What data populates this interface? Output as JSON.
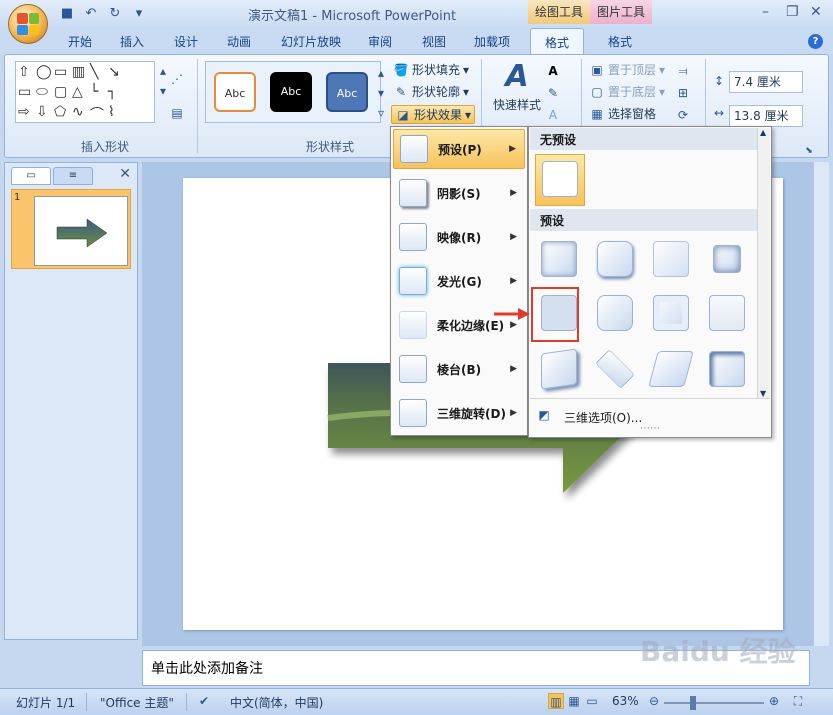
{
  "title_bar": {
    "title": "演示文稿1 - Microsoft PowerPoint",
    "context_drawing": "绘图工具",
    "context_picture": "图片工具"
  },
  "tabs": [
    "开始",
    "插入",
    "设计",
    "动画",
    "幻灯片放映",
    "审阅",
    "视图",
    "加载项",
    "格式",
    "格式"
  ],
  "ribbon": {
    "insert_shapes_label": "插入形状",
    "shape_styles_label": "形状样式",
    "style_samples": [
      "Abc",
      "Abc",
      "Abc"
    ],
    "shape_fill": "形状填充",
    "shape_outline": "形状轮廓",
    "shape_effects": "形状效果",
    "quick_styles": "快速样式",
    "bring_front": "置于顶层",
    "send_back": "置于底层",
    "selection_pane": "选择窗格",
    "height": "7.4 厘米",
    "width": "13.8 厘米"
  },
  "menu_effects": {
    "items": [
      "预设(P)",
      "阴影(S)",
      "映像(R)",
      "发光(G)",
      "柔化边缘(E)",
      "棱台(B)",
      "三维旋转(D)"
    ]
  },
  "menu_presets": {
    "no_preset_header": "无预设",
    "presets_header": "预设",
    "more_options": "三维选项(O)..."
  },
  "notes": {
    "placeholder": "单击此处添加备注"
  },
  "status": {
    "slide": "幻灯片 1/1",
    "theme": "\"Office 主题\"",
    "language": "中文(简体，中国)",
    "zoom": "63%"
  },
  "watermark": "Baidu 经验",
  "colors": {
    "accent_orange": "#f7c25a",
    "highlight_red": "#e03a2a",
    "ribbon_blue": "#c9dbf2"
  }
}
